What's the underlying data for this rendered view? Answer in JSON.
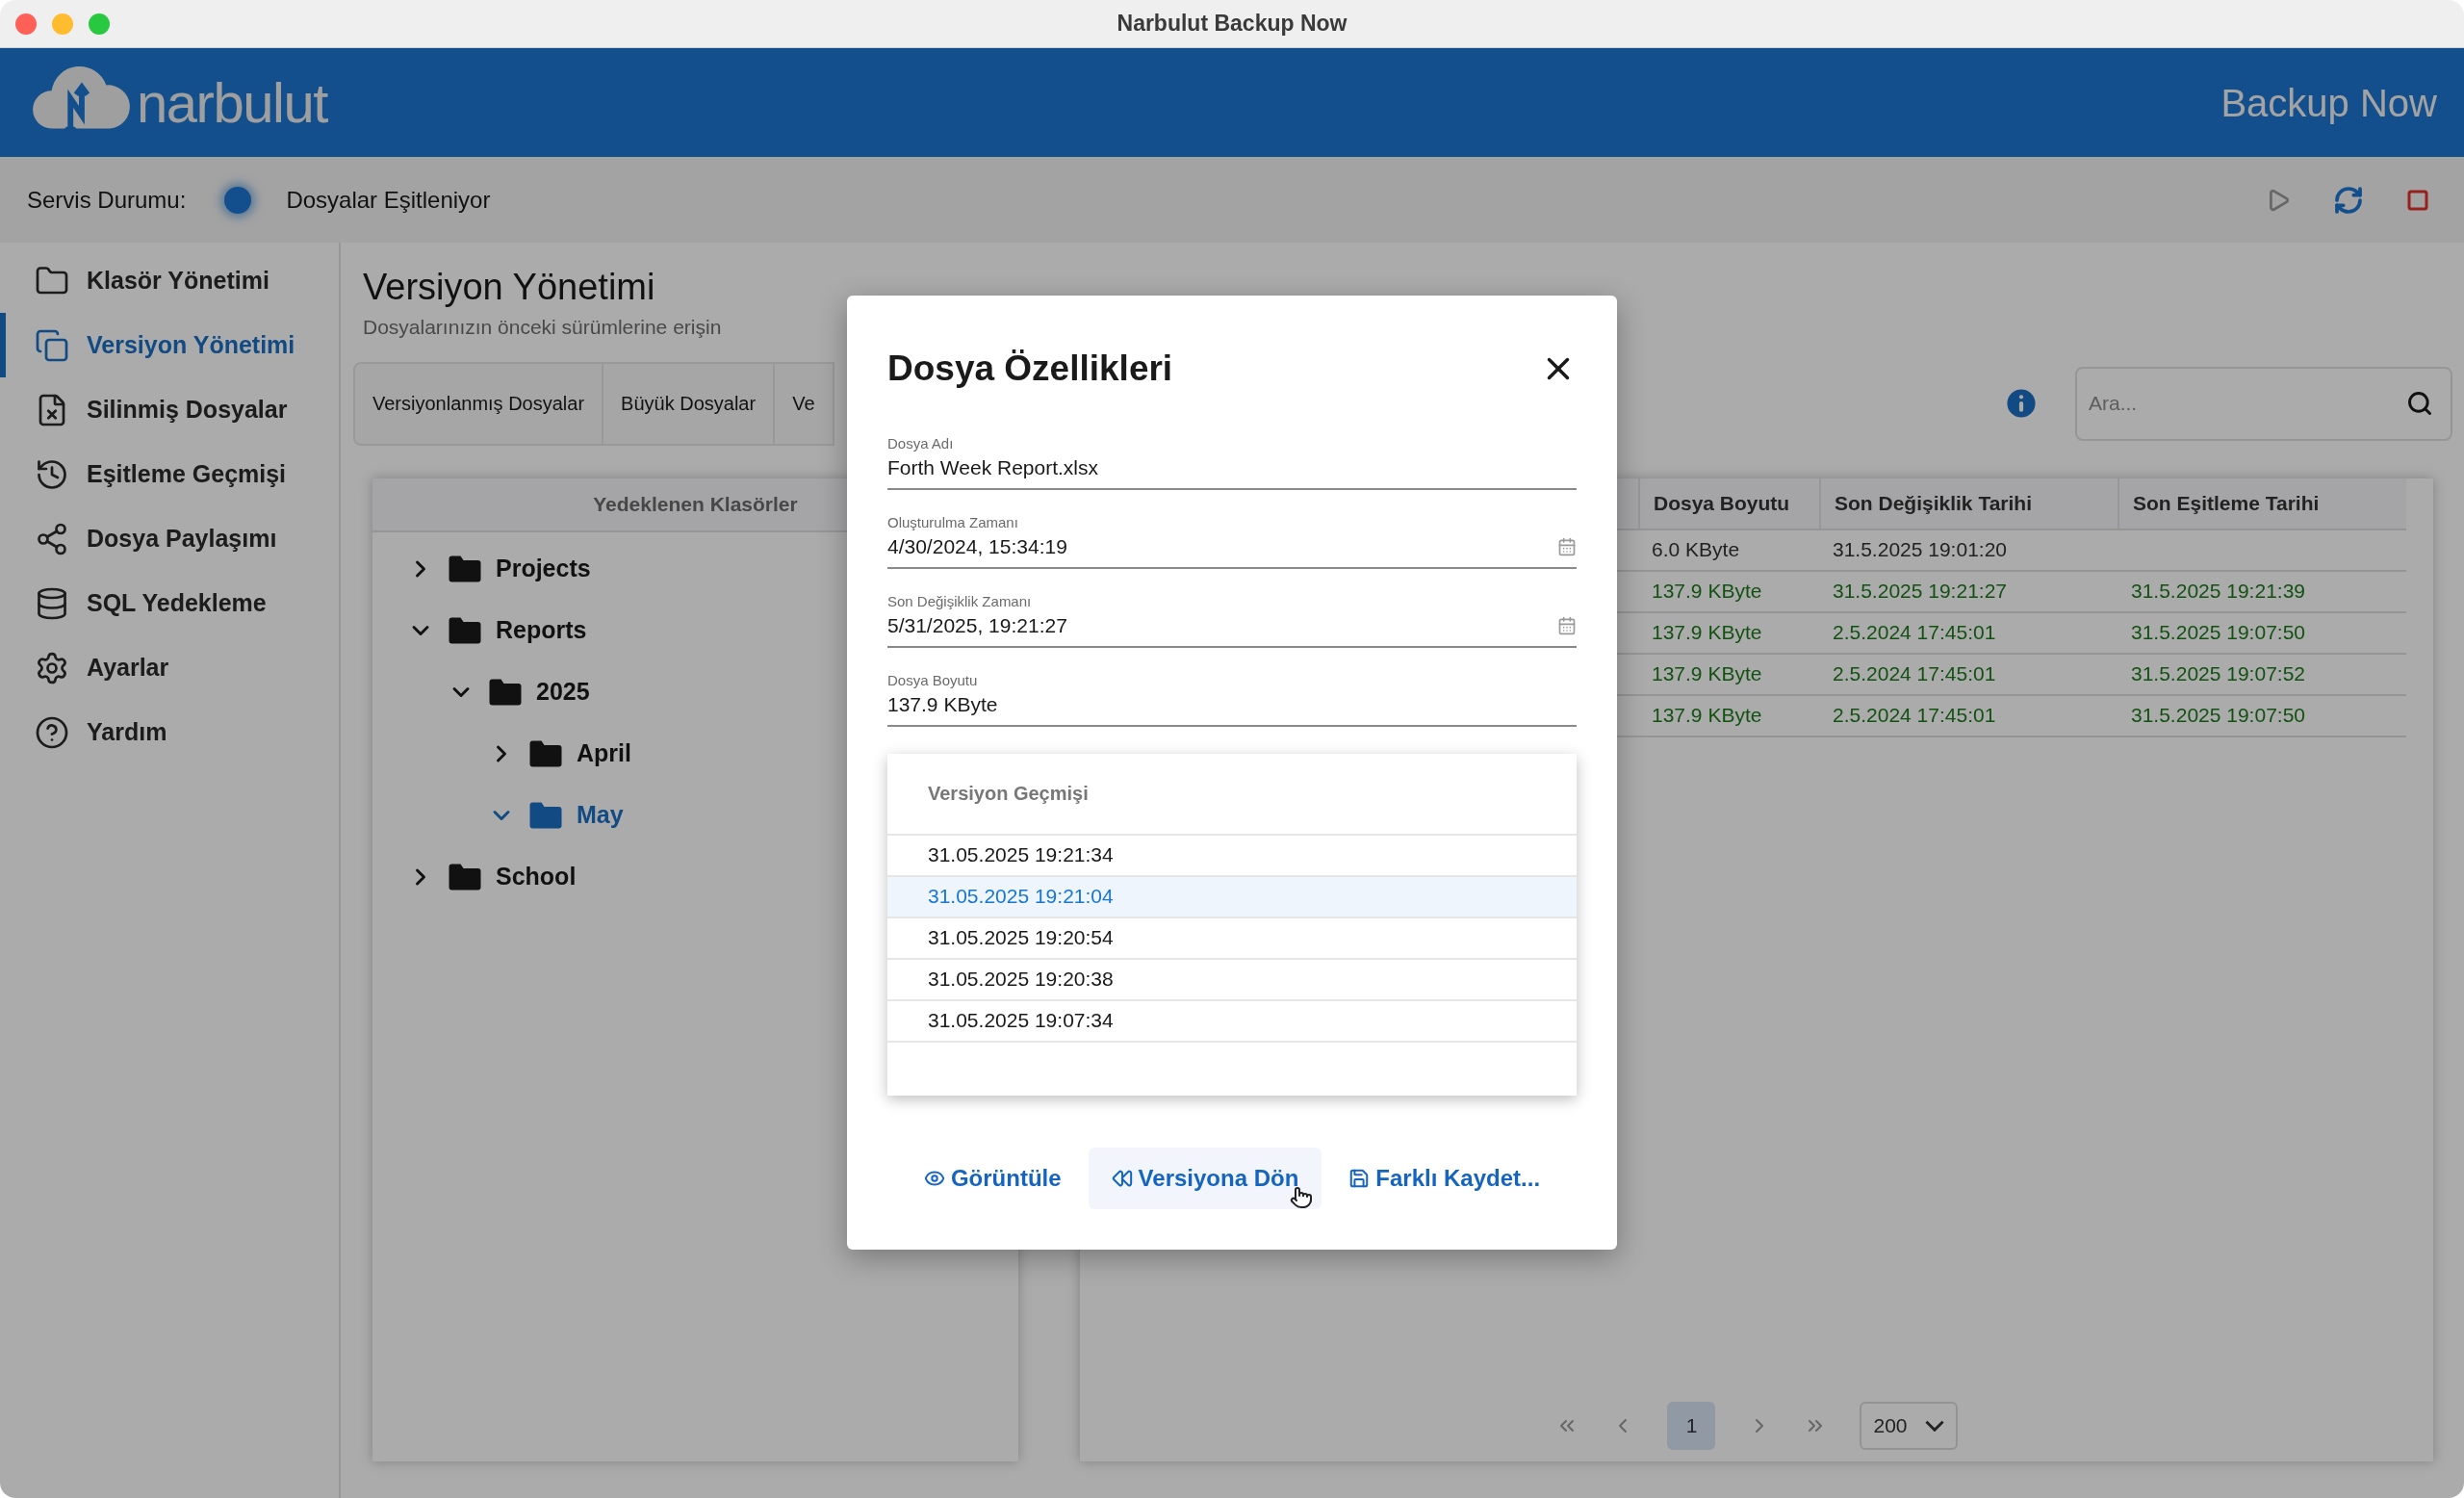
{
  "window": {
    "title": "Narbulut Backup Now"
  },
  "header": {
    "logo_text": "narbulut",
    "app_name": "Backup Now"
  },
  "status": {
    "label": "Servis Durumu:",
    "text": "Dosyalar Eşitleniyor"
  },
  "sidebar": {
    "items": [
      {
        "label": "Klasör Yönetimi",
        "selected": false
      },
      {
        "label": "Versiyon Yönetimi",
        "selected": true
      },
      {
        "label": "Silinmiş Dosyalar",
        "selected": false
      },
      {
        "label": "Eşitleme Geçmişi",
        "selected": false
      },
      {
        "label": "Dosya Paylaşımı",
        "selected": false
      },
      {
        "label": "SQL Yedekleme",
        "selected": false
      },
      {
        "label": "Ayarlar",
        "selected": false
      },
      {
        "label": "Yardım",
        "selected": false
      }
    ]
  },
  "page": {
    "title": "Versiyon Yönetimi",
    "subtitle": "Dosyalarınızın önceki sürümlerine erişin"
  },
  "tabs": [
    {
      "label": "Versiyonlanmış Dosyalar"
    },
    {
      "label": "Büyük Dosyalar"
    },
    {
      "label": "Ve"
    }
  ],
  "search": {
    "placeholder": "Ara..."
  },
  "tree": {
    "title": "Yedeklenen Klasörler",
    "items": [
      {
        "label": "Projects",
        "expanded": false,
        "selected": false
      },
      {
        "label": "Reports",
        "expanded": true,
        "selected": false,
        "children": [
          {
            "label": "2025",
            "expanded": true,
            "selected": false,
            "children": [
              {
                "label": "April",
                "expanded": false,
                "selected": false
              },
              {
                "label": "May",
                "expanded": true,
                "selected": true
              }
            ]
          }
        ]
      },
      {
        "label": "School",
        "expanded": false,
        "selected": false
      }
    ]
  },
  "table": {
    "columns": [
      "Dosya Boyutu",
      "Son Değişiklik Tarihi",
      "Son Eşitleme Tarihi"
    ],
    "rows": [
      {
        "synced": false,
        "size": "6.0 KByte",
        "modified": "31.5.2025 19:01:20"
      },
      {
        "synced": true,
        "size": "137.9 KByte",
        "modified": "31.5.2025 19:21:27",
        "synced_at": "31.5.2025 19:21:39"
      },
      {
        "synced": true,
        "size": "137.9 KByte",
        "modified": "2.5.2024 17:45:01",
        "synced_at": "31.5.2025 19:07:50"
      },
      {
        "synced": true,
        "size": "137.9 KByte",
        "modified": "2.5.2024 17:45:01",
        "synced_at": "31.5.2025 19:07:52"
      },
      {
        "synced": true,
        "size": "137.9 KByte",
        "modified": "2.5.2024 17:45:01",
        "synced_at": "31.5.2025 19:07:50"
      }
    ]
  },
  "pagination": {
    "pages": [
      {
        "label": "1",
        "selected": true
      }
    ],
    "page_size": "200"
  },
  "dialog": {
    "title": "Dosya Özellikleri",
    "fields": [
      {
        "label": "Dosya Adı",
        "value": "Forth Week Report.xlsx",
        "kind": "text"
      },
      {
        "label": "Oluşturulma Zamanı",
        "value": "4/30/2024, 15:34:19",
        "kind": "date"
      },
      {
        "label": "Son Değişiklik Zamanı",
        "value": "5/31/2025, 19:21:27",
        "kind": "date"
      },
      {
        "label": "Dosya Boyutu",
        "value": "137.9 KByte",
        "kind": "text"
      }
    ],
    "history": {
      "title": "Versiyon Geçmişi",
      "items": [
        {
          "label": "31.05.2025 19:21:34",
          "selected": false
        },
        {
          "label": "31.05.2025 19:21:04",
          "selected": true
        },
        {
          "label": "31.05.2025 19:20:54",
          "selected": false
        },
        {
          "label": "31.05.2025 19:20:38",
          "selected": false
        },
        {
          "label": "31.05.2025 19:07:34",
          "selected": false
        }
      ]
    },
    "buttons": [
      {
        "label": "Görüntüle",
        "kind": "view",
        "hovered": false
      },
      {
        "label": "Versiyona Dön",
        "kind": "revert",
        "hovered": true
      },
      {
        "label": "Farklı Kaydet...",
        "kind": "save",
        "hovered": false
      }
    ]
  }
}
